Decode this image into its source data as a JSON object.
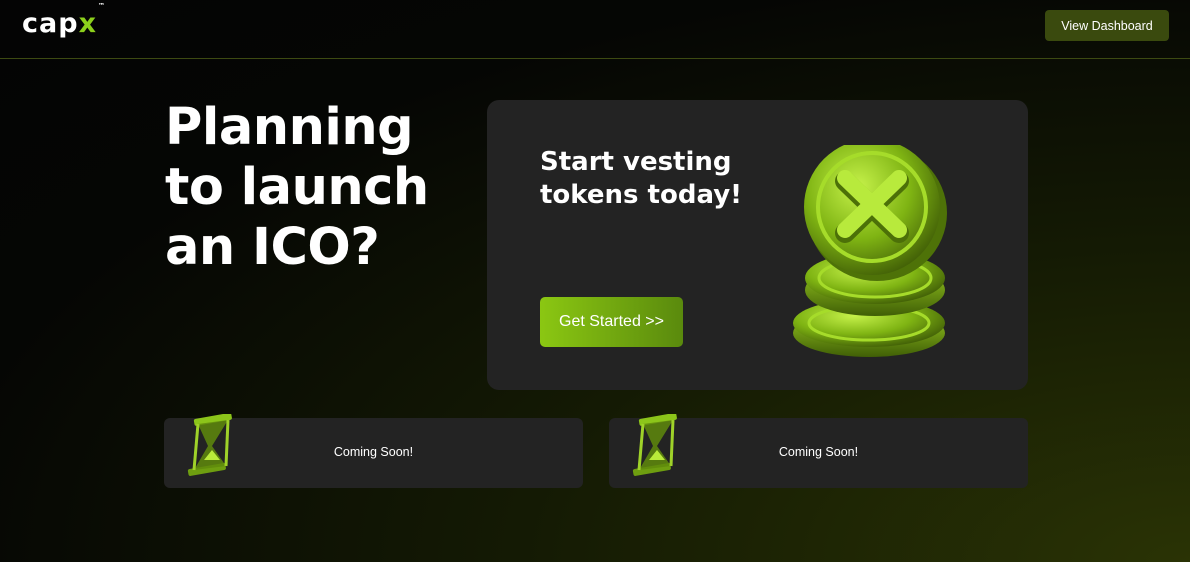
{
  "header": {
    "logo_text": "capx",
    "logo_tm": "™",
    "view_dashboard_label": "View Dashboard"
  },
  "hero": {
    "line1": "Planning",
    "line2": "to launch",
    "line3": "an ICO?"
  },
  "promo_card": {
    "title_line1": "Start vesting",
    "title_line2": "tokens today!",
    "cta_label": "Get Started >>"
  },
  "coming_soon_cards": [
    {
      "label": "Coming Soon!"
    },
    {
      "label": "Coming Soon!"
    }
  ],
  "colors": {
    "accent": "#8ccf1c",
    "button_dark_green": "#3a4a0e",
    "card_bg": "#232323"
  }
}
